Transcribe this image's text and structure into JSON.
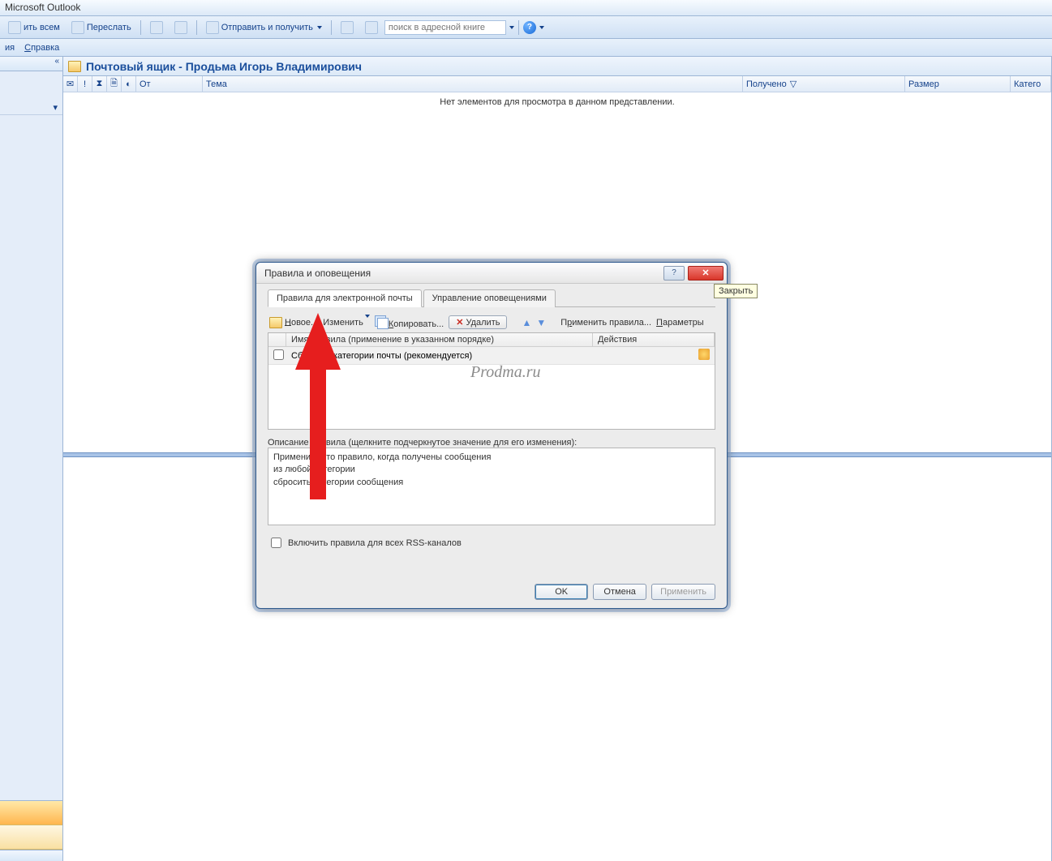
{
  "app": {
    "title": "Microsoft Outlook"
  },
  "toolbar": {
    "reply_all": "ить всем",
    "forward": "Переслать",
    "send_receive": "Отправить и получить",
    "search_placeholder": "поиск в адресной книге"
  },
  "menubar": {
    "items": [
      "ия",
      "Справка"
    ]
  },
  "main": {
    "title": "Почтовый ящик - Продьма Игорь Владимирович",
    "columns": {
      "from": "От",
      "subject": "Тема",
      "received": "Получено",
      "size": "Размер",
      "category": "Катего"
    },
    "empty": "Нет элементов для просмотра в данном представлении."
  },
  "dialog": {
    "title": "Правила и оповещения",
    "tabs": {
      "rules": "Правила для электронной почты",
      "alerts": "Управление оповещениями"
    },
    "toolbar": {
      "new": "Новое...",
      "edit": "Изменить",
      "copy": "Копировать...",
      "delete": "Удалить",
      "apply_rules": "Применить правила...",
      "options": "Параметры"
    },
    "list": {
      "col_name": "Имя правила (применение в указанном порядке)",
      "col_actions": "Действия",
      "rule1": "Сбросить категории почты (рекомендуется)"
    },
    "description_label": "Описание правила (щелкните подчеркнутое значение для его изменения):",
    "description_lines": [
      "Применить это правило, когда получены сообщения",
      "из любой категории",
      "сбросить категории сообщения"
    ],
    "rss_checkbox": "Включить правила для всех RSS-каналов",
    "buttons": {
      "ok": "OK",
      "cancel": "Отмена",
      "apply": "Применить"
    },
    "close_tooltip": "Закрыть"
  },
  "watermark": "Prodma.ru"
}
